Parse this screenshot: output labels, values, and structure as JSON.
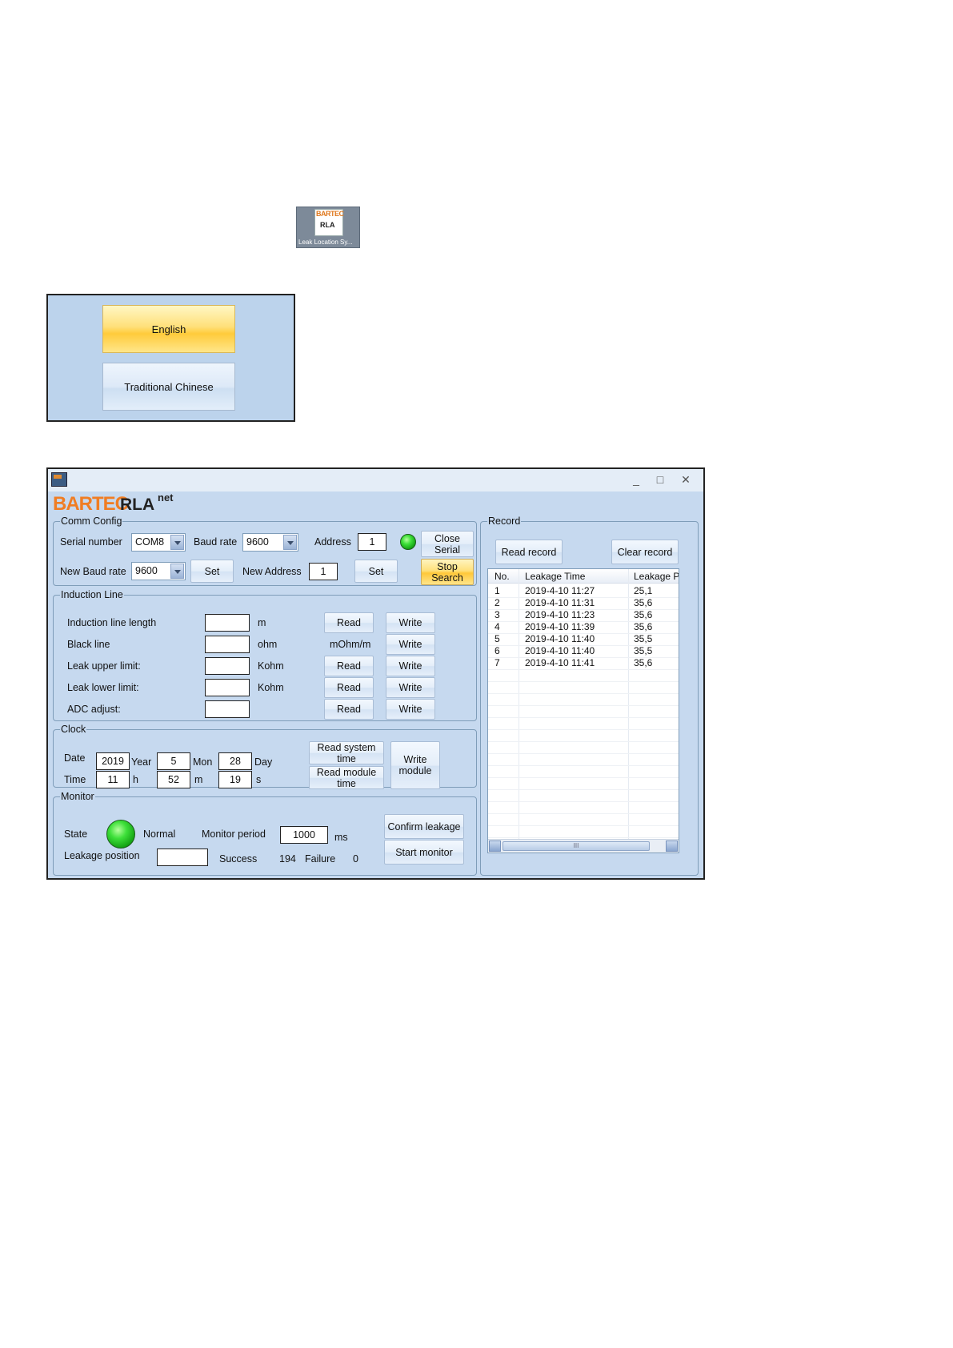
{
  "desktop_icon": {
    "brand": "BARTEC",
    "product": "RLA",
    "caption": "Leak Location Sy..."
  },
  "language": {
    "english": "English",
    "traditional_chinese": "Traditional Chinese"
  },
  "window": {
    "minimize": "_",
    "maximize": "□",
    "close": "✕",
    "brand": "BARTEC",
    "product": "RLA",
    "product_sup": "net"
  },
  "comm": {
    "legend": "Comm Config",
    "serial_label": "Serial number",
    "serial_value": "COM8",
    "baud_label": "Baud rate",
    "baud_value": "9600",
    "address_label": "Address",
    "address_value": "1",
    "new_baud_label": "New Baud rate",
    "new_baud_value": "9600",
    "set1": "Set",
    "new_address_label": "New Address",
    "new_address_value": "1",
    "set2": "Set",
    "close_serial": "Close Serial",
    "stop_search": "Stop Search"
  },
  "induction": {
    "legend": "Induction Line",
    "rows": [
      {
        "label": "Induction line length",
        "unit": "m",
        "read": "Read",
        "write": "Write"
      },
      {
        "label": "Black line",
        "unit": "ohm",
        "unit2": "mOhm/m",
        "write": "Write"
      },
      {
        "label": "Leak upper limit:",
        "unit": "Kohm",
        "read": "Read",
        "write": "Write"
      },
      {
        "label": "Leak lower limit:",
        "unit": "Kohm",
        "read": "Read",
        "write": "Write"
      },
      {
        "label": "ADC adjust:",
        "read": "Read",
        "write": "Write"
      }
    ]
  },
  "clock": {
    "legend": "Clock",
    "date_label": "Date",
    "year": "2019",
    "year_label": "Year",
    "mon": "5",
    "mon_label": "Mon",
    "day": "28",
    "day_label": "Day",
    "time_label": "Time",
    "h": "11",
    "h_label": "h",
    "m": "52",
    "m_label": "m",
    "s": "19",
    "s_label": "s",
    "read_system_time": "Read system time",
    "read_module_time": "Read module time",
    "write_module": "Write module"
  },
  "monitor": {
    "legend": "Monitor",
    "state_label": "State",
    "state_value": "Normal",
    "period_label": "Monitor period",
    "period_value": "1000",
    "period_unit": "ms",
    "leak_pos_label": "Leakage position",
    "leak_pos_value": "",
    "success_label": "Success",
    "success_value": "194",
    "failure_label": "Failure",
    "failure_value": "0",
    "confirm_leakage": "Confirm leakage",
    "start_monitor": "Start monitor"
  },
  "record": {
    "legend": "Record",
    "read_record": "Read record",
    "clear_record": "Clear record",
    "columns": [
      "No.",
      "Leakage Time",
      "Leakage Pos"
    ],
    "rows": [
      [
        "1",
        "2019-4-10 11:27",
        "25,1"
      ],
      [
        "2",
        "2019-4-10 11:31",
        "35,6"
      ],
      [
        "3",
        "2019-4-10 11:23",
        "35,6"
      ],
      [
        "4",
        "2019-4-10 11:39",
        "35,6"
      ],
      [
        "5",
        "2019-4-10 11:40",
        "35,5"
      ],
      [
        "6",
        "2019-4-10 11:40",
        "35,5"
      ],
      [
        "7",
        "2019-4-10 11:41",
        "35,6"
      ]
    ],
    "scroll_grip": "III"
  }
}
